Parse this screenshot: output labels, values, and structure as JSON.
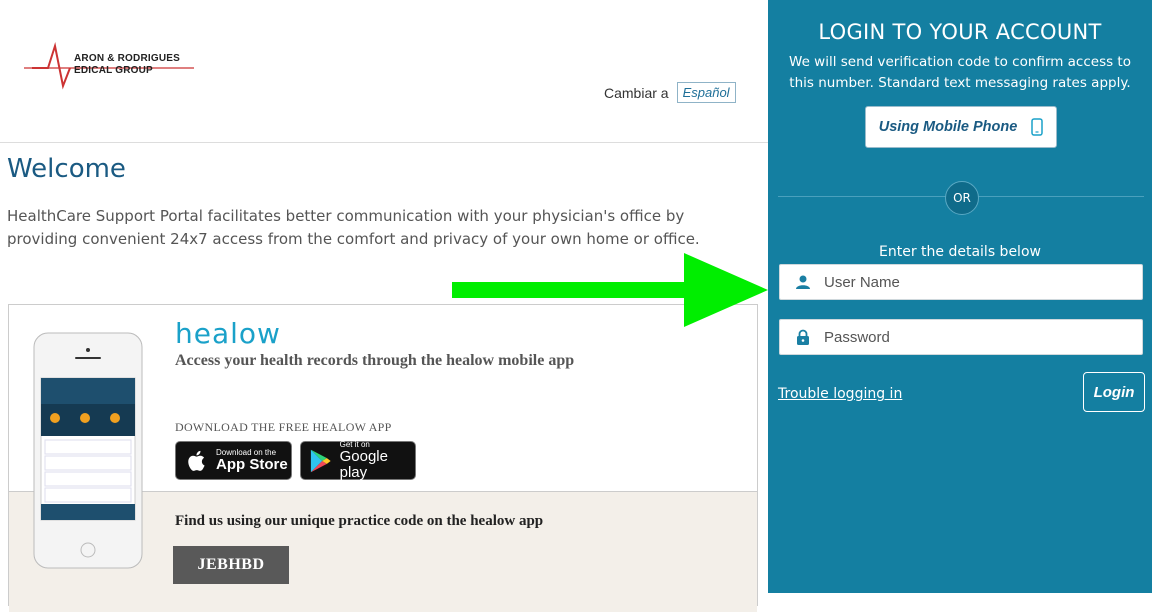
{
  "logo": {
    "line1": "ARON & RODRIGUES",
    "line2": "EDICAL GROUP"
  },
  "language": {
    "prompt": "Cambiar a",
    "option": "Español"
  },
  "welcome": {
    "title": "Welcome",
    "text": "HealthCare Support Portal facilitates better communication with your physician's office by providing convenient 24x7 access from the comfort and privacy of your own home or office."
  },
  "healow": {
    "brand": "healow",
    "tagline": "Access your health records through the healow mobile app",
    "download_label": "DOWNLOAD THE FREE HEALOW APP",
    "appstore_small": "Download on the",
    "appstore_big": "App Store",
    "googleplay_small": "Get it on",
    "googleplay_big": "Google play",
    "find_text": "Find us using our unique practice code on the healow app",
    "practice_code": "JEBHBD"
  },
  "login": {
    "title": "LOGIN TO YOUR ACCOUNT",
    "subtitle": "We will send verification code to confirm access to this number. Standard text messaging rates apply.",
    "mobile_button": "Using Mobile Phone",
    "or": "OR",
    "enter_details": "Enter the details below",
    "username_placeholder": "User Name",
    "password_placeholder": "Password",
    "trouble": "Trouble logging in",
    "login_button": "Login"
  },
  "colors": {
    "panel": "#147fa1",
    "arrow": "#00ee00",
    "accent": "#1aa1c9"
  }
}
